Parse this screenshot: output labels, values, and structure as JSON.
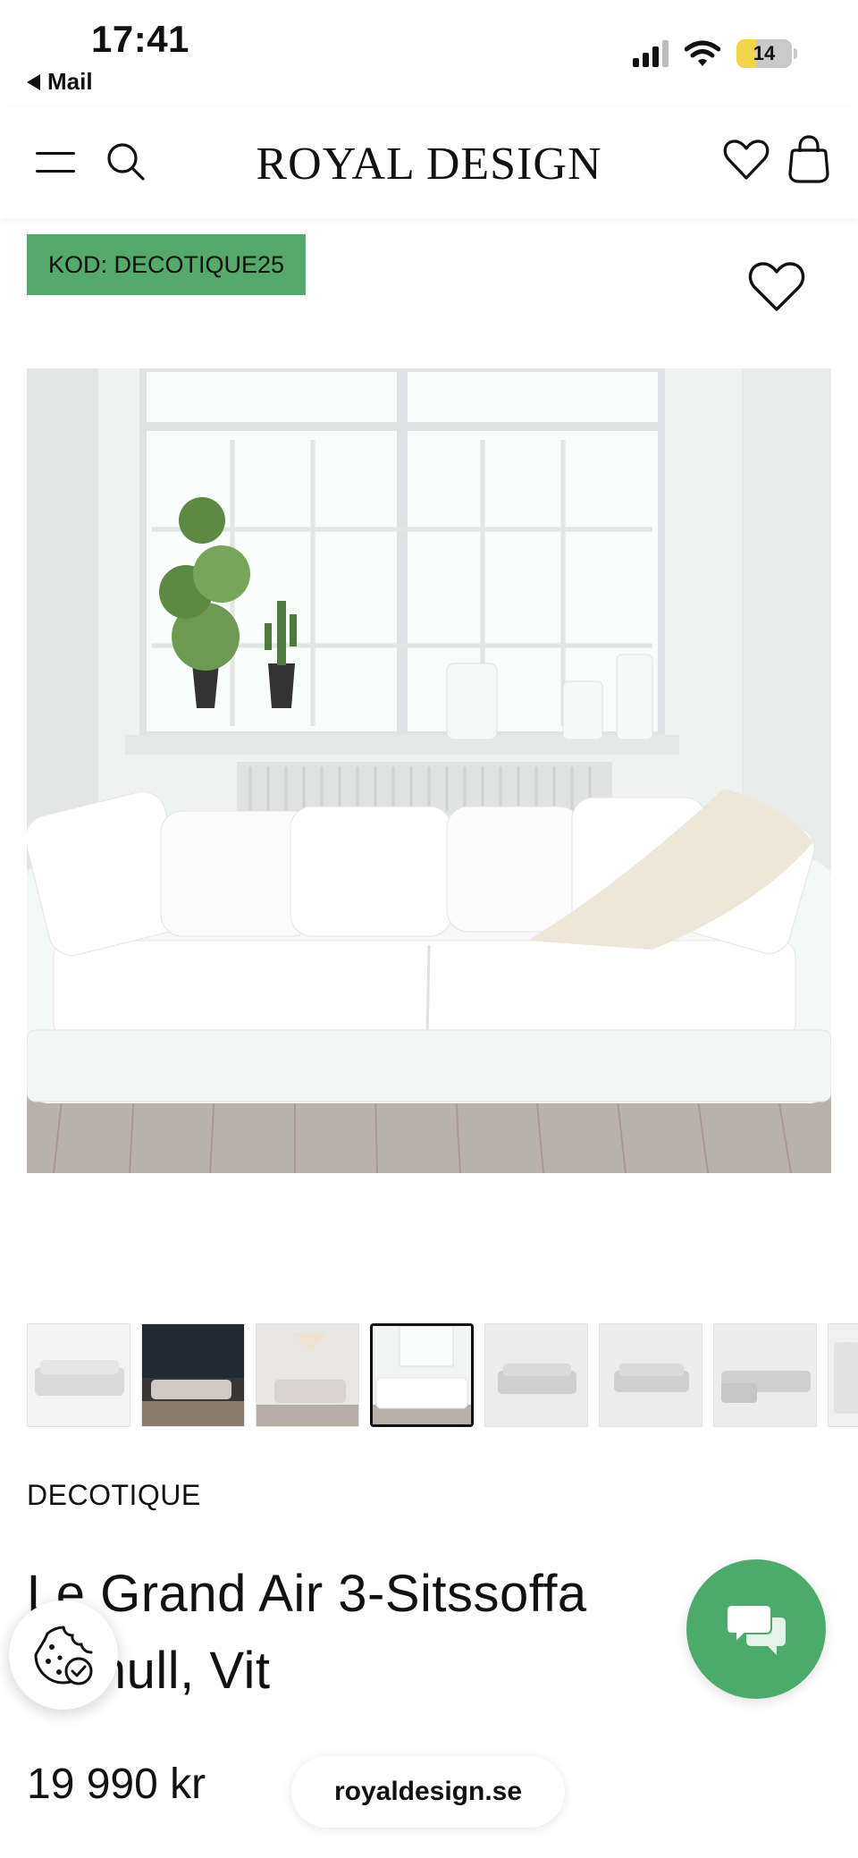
{
  "status_bar": {
    "time": "17:41",
    "back_label": "Mail",
    "battery_level": "14",
    "icons": [
      "cellular-signal-icon",
      "wifi-icon",
      "battery-icon"
    ]
  },
  "header": {
    "logo": "ROYAL DESIGN",
    "icons": [
      "menu-icon",
      "search-icon",
      "heart-icon",
      "shopping-bag-icon"
    ]
  },
  "product": {
    "promo_code": "KOD: DECOTIQUE25",
    "brand": "DECOTIQUE",
    "title": "Le Grand Air 3-Sitssoffa Linnull, Vit",
    "price": "19 990 kr",
    "thumbnail_count": 8,
    "active_thumbnail": 4
  },
  "floating": {
    "url": "royaldesign.se",
    "chat_icon": "chat-bubbles-icon",
    "cookie_icon": "cookie-settings-icon"
  },
  "colors": {
    "accent_green": "#4caa6b",
    "badge_green": "#55a96a"
  }
}
